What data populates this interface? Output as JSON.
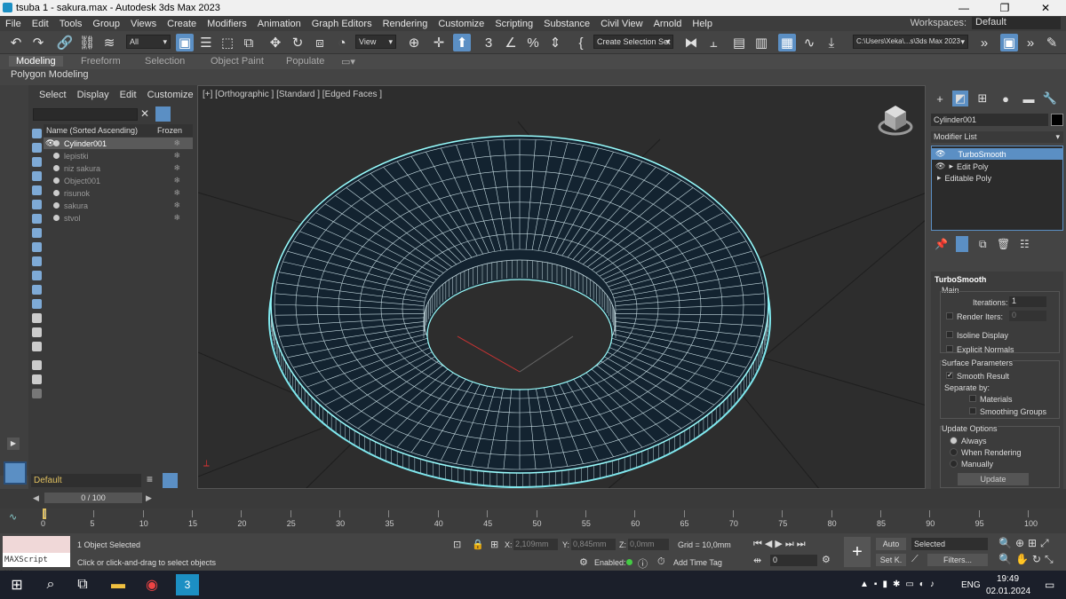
{
  "window": {
    "title": "tsuba 1 - sakura.max - Autodesk 3ds Max 2023"
  },
  "menu": [
    "File",
    "Edit",
    "Tools",
    "Group",
    "Views",
    "Create",
    "Modifiers",
    "Animation",
    "Graph Editors",
    "Rendering",
    "Customize",
    "Scripting",
    "Substance",
    "Civil View",
    "Arnold",
    "Help"
  ],
  "workspace": {
    "label": "Workspaces:",
    "value": "Default"
  },
  "toolbar": {
    "filter": "All",
    "view": "View",
    "selection_set": "Create Selection Set",
    "path": "C:\\Users\\Xeka\\...s\\3ds Max 2023"
  },
  "ribbon": {
    "tabs": [
      "Modeling",
      "Freeform",
      "Selection",
      "Object Paint",
      "Populate"
    ],
    "sub": "Polygon Modeling"
  },
  "scene_explorer": {
    "tabs": [
      "Select",
      "Display",
      "Edit",
      "Customize"
    ],
    "col_name": "Name (Sorted Ascending)",
    "col_frozen": "Frozen",
    "rows": [
      "Cylinder001",
      "lepistki",
      "niz sakura",
      "Object001",
      "risunok",
      "sakura",
      "stvol"
    ]
  },
  "viewport": {
    "label": "[+] [Orthographic ] [Standard ] [Edged Faces ]"
  },
  "command_panel": {
    "object_name": "Cylinder001",
    "modifier_list": "Modifier List",
    "stack": [
      "TurboSmooth",
      "Edit Poly",
      "Editable Poly"
    ],
    "rollout_title": "TurboSmooth",
    "main": "Main",
    "iterations_label": "Iterations:",
    "iterations_value": "1",
    "render_iters_label": "Render Iters:",
    "render_iters_value": "0",
    "isoline": "Isoline Display",
    "explicit_normals": "Explicit Normals",
    "surface_params": "Surface Parameters",
    "smooth_result": "Smooth Result",
    "separate_by": "Separate by:",
    "materials": "Materials",
    "smoothing_groups": "Smoothing Groups",
    "update_options": "Update Options",
    "always": "Always",
    "when_rendering": "When Rendering",
    "manually": "Manually",
    "update_button": "Update"
  },
  "layer": {
    "name": "Default"
  },
  "timeline": {
    "slider": "0 / 100",
    "ticks": [
      "0",
      "5",
      "10",
      "15",
      "20",
      "25",
      "30",
      "35",
      "40",
      "45",
      "50",
      "55",
      "60",
      "65",
      "70",
      "75",
      "80",
      "85",
      "90",
      "95",
      "100"
    ]
  },
  "status": {
    "maxscript": "MAXScript Mini",
    "selected": "1 Object Selected",
    "prompt": "Click or click-and-drag to select objects",
    "x_label": "X:",
    "x": "2,109mm",
    "y_label": "Y:",
    "y": "0,845mm",
    "z_label": "Z:",
    "z": "0,0mm",
    "grid": "Grid = 10,0mm",
    "enabled": "Enabled:",
    "add_time_tag": "Add Time Tag",
    "auto": "Auto",
    "selected_dd": "Selected",
    "set_key": "Set K.",
    "filters": "Filters...",
    "frame": "0"
  },
  "taskbar": {
    "lang": "ENG",
    "time": "19:49",
    "date": "02.01.2024"
  }
}
